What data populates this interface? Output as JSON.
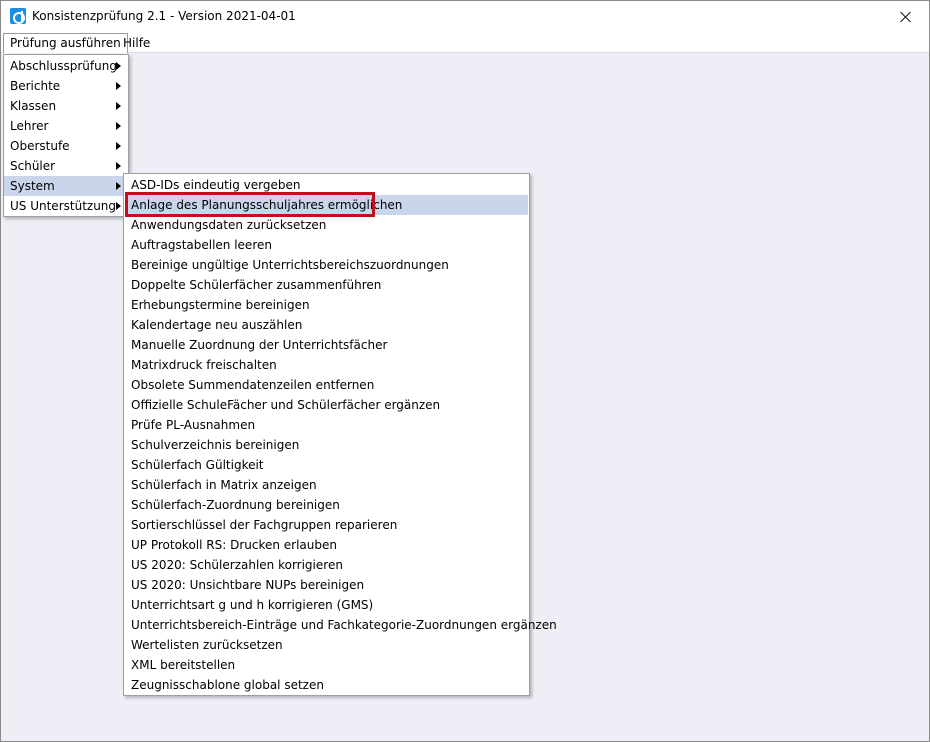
{
  "window": {
    "title": "Konsistenzprüfung 2.1 - Version 2021-04-01"
  },
  "menubar": [
    {
      "label": "Prüfung ausführen"
    },
    {
      "label": "Hilfe"
    }
  ],
  "main_menu": [
    {
      "label": "Abschlussprüfung"
    },
    {
      "label": "Berichte"
    },
    {
      "label": "Klassen"
    },
    {
      "label": "Lehrer"
    },
    {
      "label": "Oberstufe"
    },
    {
      "label": "Schüler"
    },
    {
      "label": "System"
    },
    {
      "label": "US Unterstützung"
    }
  ],
  "system_submenu": [
    {
      "label": "ASD-IDs eindeutig vergeben"
    },
    {
      "label": "Anlage des Planungsschuljahres ermöglichen"
    },
    {
      "label": "Anwendungsdaten zurücksetzen"
    },
    {
      "label": "Auftragstabellen leeren"
    },
    {
      "label": "Bereinige ungültige Unterrichtsbereichszuordnungen"
    },
    {
      "label": "Doppelte Schülerfächer zusammenführen"
    },
    {
      "label": "Erhebungstermine bereinigen"
    },
    {
      "label": "Kalendertage neu auszählen"
    },
    {
      "label": "Manuelle Zuordnung der Unterrichtsfächer"
    },
    {
      "label": "Matrixdruck freischalten"
    },
    {
      "label": "Obsolete Summendatenzeilen entfernen"
    },
    {
      "label": "Offizielle SchuleFächer und Schülerfächer ergänzen"
    },
    {
      "label": "Prüfe PL-Ausnahmen"
    },
    {
      "label": "Schulverzeichnis bereinigen"
    },
    {
      "label": "Schülerfach Gültigkeit"
    },
    {
      "label": "Schülerfach in Matrix anzeigen"
    },
    {
      "label": "Schülerfach-Zuordnung bereinigen"
    },
    {
      "label": "Sortierschlüssel der Fachgruppen reparieren"
    },
    {
      "label": "UP Protokoll RS: Drucken erlauben"
    },
    {
      "label": "US 2020: Schülerzahlen korrigieren"
    },
    {
      "label": "US 2020: Unsichtbare NUPs bereinigen"
    },
    {
      "label": "Unterrichtsart g und h korrigieren (GMS)"
    },
    {
      "label": "Unterrichtsbereich-Einträge und Fachkategorie-Zuordnungen ergänzen"
    },
    {
      "label": "Wertelisten zurücksetzen"
    },
    {
      "label": "XML bereitstellen"
    },
    {
      "label": "Zeugnisschablone global setzen"
    }
  ],
  "colors": {
    "hover": "#c9d5ea",
    "highlight_border": "#c01020",
    "client_bg": "#eeeef6"
  }
}
